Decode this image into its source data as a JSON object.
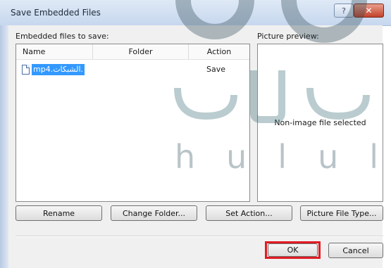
{
  "window": {
    "title": "Save Embedded Files",
    "help_glyph": "?",
    "close_glyph": "✕"
  },
  "files_panel": {
    "label": "Embedded files to save:",
    "columns": [
      "Name",
      "Folder",
      "Action"
    ],
    "rows": [
      {
        "name": ".الشبكات.mp4",
        "folder": "",
        "action": "Save",
        "icon": "file-icon"
      }
    ]
  },
  "preview_panel": {
    "label": "Picture preview:",
    "message": "Non-image file selected"
  },
  "buttons": {
    "rename": "Rename",
    "change_folder": "Change Folder...",
    "set_action": "Set Action...",
    "picture_file_type": "Picture File Type...",
    "ok": "OK",
    "cancel": "Cancel"
  },
  "watermark": {
    "arabic": "حلول",
    "latin": "hulul"
  },
  "colors": {
    "selection": "#3399ff",
    "highlight_box": "#e11b22",
    "titlebar": "#c6d7ee"
  }
}
